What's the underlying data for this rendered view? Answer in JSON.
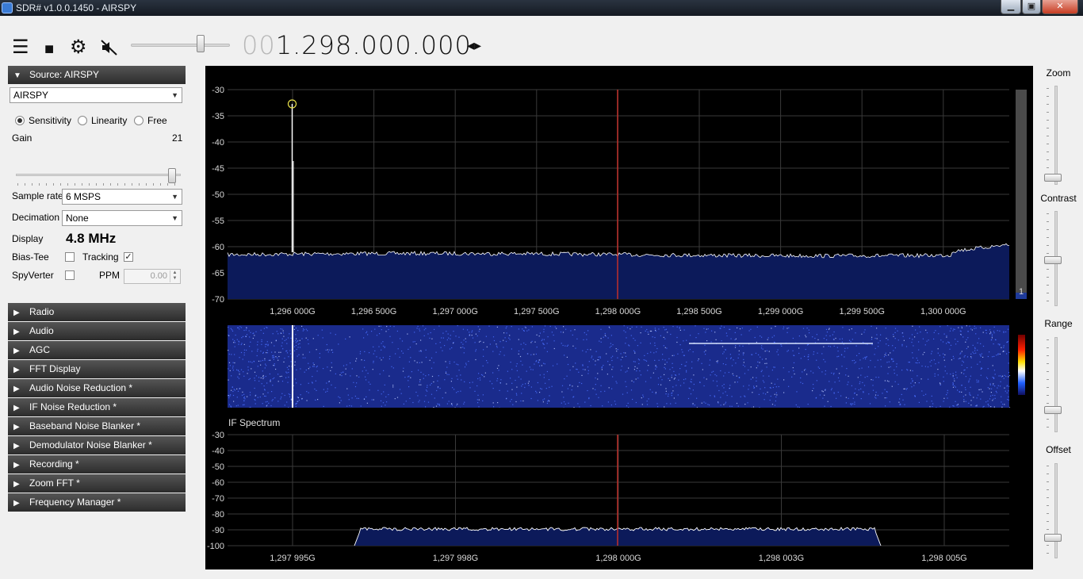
{
  "window": {
    "title": "SDR# v1.0.0.1450 - AIRSPY",
    "minimize_glyph": "▁",
    "maximize_glyph": "▣",
    "close_glyph": "✕"
  },
  "toolbar": {
    "menu_icon": "hamburger-menu-icon",
    "stop_icon": "stop-icon",
    "settings_icon": "gear-icon",
    "mute_icon": "speaker-mute-icon",
    "frequency_leading": "00",
    "frequency_value": "1.298.000.000",
    "frequency_arrows": "◂▸"
  },
  "source_panel": {
    "header": "Source: AIRSPY",
    "device": "AIRSPY",
    "modes": [
      "Sensitivity",
      "Linearity",
      "Free"
    ],
    "selected_mode": "Sensitivity",
    "gain_label": "Gain",
    "gain_value": "21",
    "gain_level": 1.0,
    "sample_rate_label": "Sample rate",
    "sample_rate": "6 MSPS",
    "decimation_label": "Decimation",
    "decimation": "None",
    "display_label": "Display",
    "display_value": "4.8 MHz",
    "bias_tee_label": "Bias-Tee",
    "bias_tee_checked": false,
    "tracking_label": "Tracking",
    "tracking_checked": true,
    "spyverter_label": "SpyVerter",
    "spyverter_checked": false,
    "ppm_label": "PPM",
    "ppm_value": "0.00"
  },
  "sections": [
    "Radio",
    "Audio",
    "AGC",
    "FFT Display",
    "Audio Noise Reduction *",
    "IF Noise Reduction *",
    "Baseband Noise Blanker *",
    "Demodulator Noise Blanker *",
    "Recording *",
    "Zoom FFT *",
    "Frequency Manager *"
  ],
  "right_sliders": {
    "zoom": "Zoom",
    "contrast": "Contrast",
    "range": "Range",
    "offset": "Offset"
  },
  "spectrum": {
    "y_ticks": [
      "-30",
      "-35",
      "-40",
      "-45",
      "-50",
      "-55",
      "-60",
      "-65",
      "-70"
    ],
    "x_ticks": [
      "1,296 000G",
      "1,296 500G",
      "1,297 000G",
      "1,297 500G",
      "1,298 000G",
      "1,298 500G",
      "1,299 000G",
      "1,299 500G",
      "1,300 000G"
    ],
    "scrollbar_number": "1",
    "colors": {
      "trace": "#ffffff",
      "fill": "#0c1a5a",
      "center_line": "#c0302a",
      "marker": "#e8e04a"
    }
  },
  "if_spectrum": {
    "title": "IF Spectrum",
    "y_ticks": [
      "-30",
      "-40",
      "-50",
      "-60",
      "-70",
      "-80",
      "-90",
      "-100"
    ],
    "x_ticks": [
      "1,297 995G",
      "1,297 998G",
      "1,298 000G",
      "1,298 003G",
      "1,298 005G"
    ]
  },
  "waterfall": {
    "colors": {
      "background": "#1a2b8c",
      "noise": "#4a70ff",
      "signal": "#ffffff"
    }
  }
}
